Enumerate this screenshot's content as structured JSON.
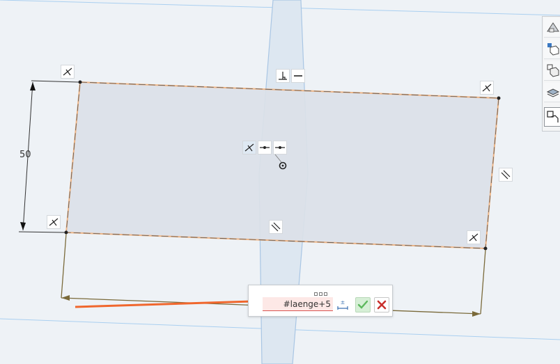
{
  "sketch": {
    "vertical_dimension": "50",
    "edit_dimension": {
      "value": "#laenge+5",
      "accept_label": "accept",
      "cancel_label": "cancel"
    }
  },
  "toolbar": {
    "tools": [
      "view-cube-icon",
      "cube-icon",
      "section-view-icon",
      "layers-icon",
      "sketch-tool-icon"
    ]
  },
  "colors": {
    "background": "#eef2f6",
    "plane_line": "#a9cff0",
    "region_fill": "#dde3ea",
    "edge_highlight": "#f0a86b",
    "dimension_line": "#7a6a3a",
    "arrow": "#f0672d",
    "error_input": "#fde8e6",
    "cancel_x": "#c9302c",
    "accept_check": "#5cb85c"
  }
}
